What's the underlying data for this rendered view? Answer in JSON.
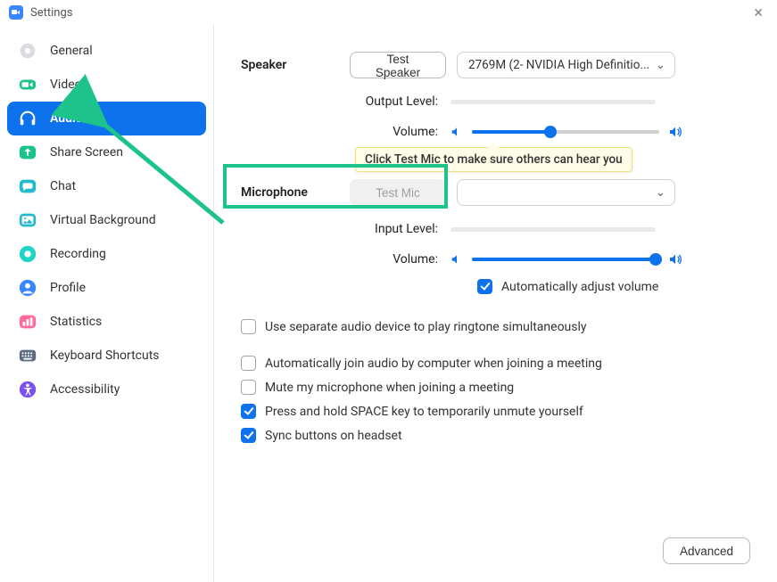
{
  "window": {
    "title": "Settings"
  },
  "sidebar": {
    "items": [
      {
        "label": "General"
      },
      {
        "label": "Video"
      },
      {
        "label": "Audio"
      },
      {
        "label": "Share Screen"
      },
      {
        "label": "Chat"
      },
      {
        "label": "Virtual Background"
      },
      {
        "label": "Recording"
      },
      {
        "label": "Profile"
      },
      {
        "label": "Statistics"
      },
      {
        "label": "Keyboard Shortcuts"
      },
      {
        "label": "Accessibility"
      }
    ],
    "active_index": 2
  },
  "speaker": {
    "heading": "Speaker",
    "test_button": "Test Speaker",
    "device": "2769M (2- NVIDIA High Definitio...",
    "output_level_label": "Output Level:",
    "volume_label": "Volume:",
    "volume_percent": 42
  },
  "microphone": {
    "heading": "Microphone",
    "test_button": "Test Mic",
    "device": "",
    "input_level_label": "Input Level:",
    "volume_label": "Volume:",
    "volume_percent": 98,
    "auto_adjust_label": "Automatically adjust volume",
    "auto_adjust_checked": true
  },
  "tooltip": {
    "text": "Click Test Mic to make sure others can hear you"
  },
  "options": {
    "ringtone": {
      "label": "Use separate audio device to play ringtone simultaneously",
      "checked": false
    },
    "auto_join": {
      "label": "Automatically join audio by computer when joining a meeting",
      "checked": false
    },
    "mute_on_join": {
      "label": "Mute my microphone when joining a meeting",
      "checked": false
    },
    "space_unmute": {
      "label": "Press and hold SPACE key to temporarily unmute yourself",
      "checked": true
    },
    "sync_headset": {
      "label": "Sync buttons on headset",
      "checked": true
    }
  },
  "advanced_button": "Advanced"
}
